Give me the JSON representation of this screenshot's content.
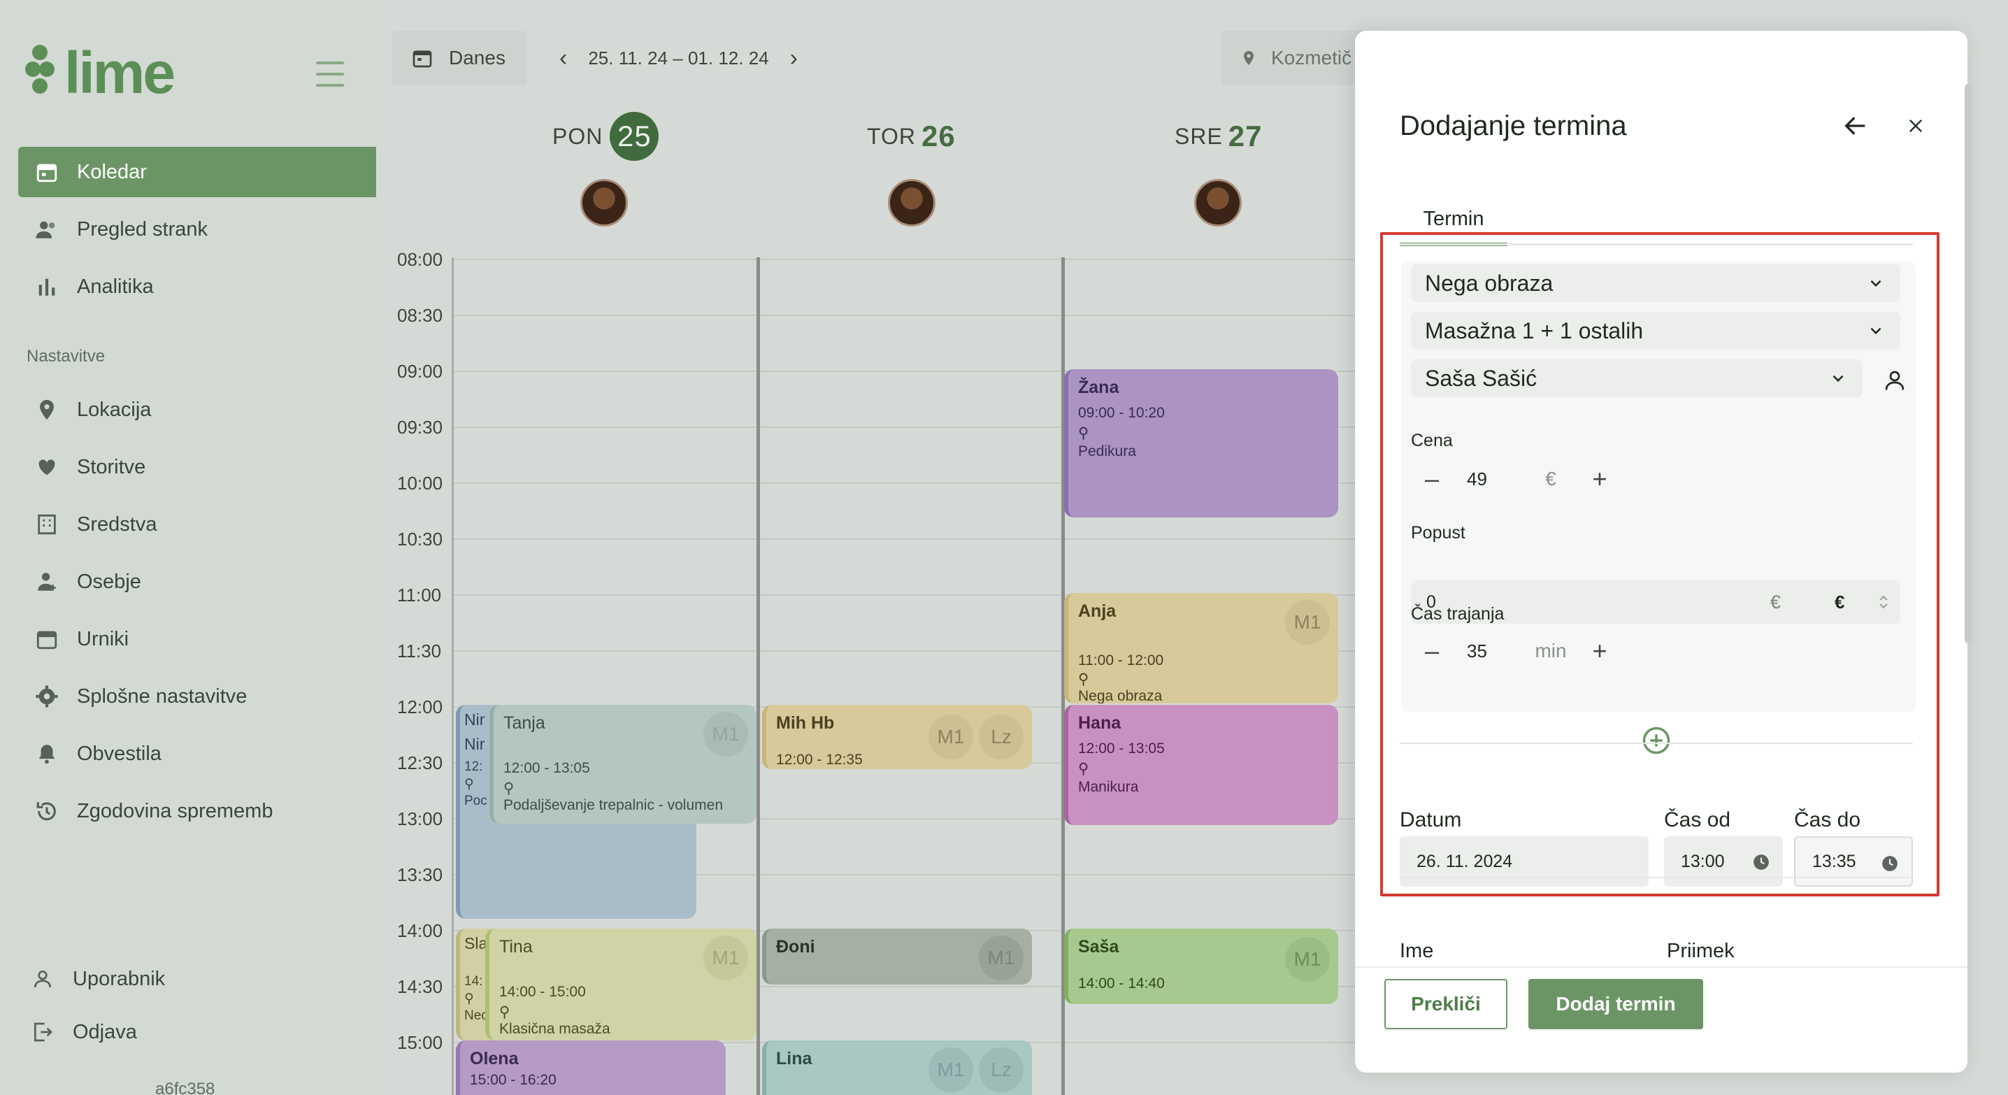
{
  "brand": {
    "name": "lime"
  },
  "sidebar": {
    "items": [
      {
        "label": "Koledar",
        "icon": "calendar-icon",
        "active": true
      },
      {
        "label": "Pregled strank",
        "icon": "users-icon"
      },
      {
        "label": "Analitika",
        "icon": "bar-chart-icon"
      }
    ],
    "section_label": "Nastavitve",
    "settings": [
      {
        "label": "Lokacija",
        "icon": "location-pin-icon"
      },
      {
        "label": "Storitve",
        "icon": "heart-hand-icon"
      },
      {
        "label": "Sredstva",
        "icon": "building-icon"
      },
      {
        "label": "Osebje",
        "icon": "staff-icon"
      },
      {
        "label": "Urniki",
        "icon": "schedule-icon"
      },
      {
        "label": "Splošne nastavitve",
        "icon": "gear-icon"
      },
      {
        "label": "Obvestila",
        "icon": "bell-icon"
      },
      {
        "label": "Zgodovina sprememb",
        "icon": "history-icon"
      }
    ],
    "user_label": "Uporabnik",
    "logout_label": "Odjava",
    "build_hash": "a6fc358"
  },
  "toolbar": {
    "today_label": "Danes",
    "date_range": "25. 11. 24 – 01. 12. 24",
    "location_label": "Kozmetič"
  },
  "days": [
    {
      "name": "PON",
      "num": "25"
    },
    {
      "name": "TOR",
      "num": "26"
    },
    {
      "name": "SRE",
      "num": "27"
    }
  ],
  "hours": [
    "08:00",
    "08:30",
    "09:00",
    "09:30",
    "10:00",
    "10:30",
    "11:00",
    "11:30",
    "12:00",
    "12:30",
    "13:00",
    "13:30",
    "14:00",
    "14:30",
    "15:00"
  ],
  "events": [
    {
      "title": "Žana",
      "time": "09:00 - 10:20",
      "service": "Pedikura"
    },
    {
      "title": "Anja",
      "time": "11:00 - 12:00",
      "service": "Nega obraza",
      "badge": "M1"
    },
    {
      "title": "Hana",
      "time": "12:00 - 13:05",
      "service": "Manikura"
    },
    {
      "title": "Saša",
      "time": "14:00 - 14:40",
      "badge": "M1"
    },
    {
      "title": "Tanja",
      "time": "12:00 - 13:05",
      "service": "Podaljševanje trepalnic - volumen",
      "badge": "M1",
      "side_a": "Nir",
      "side_b": "Nir",
      "side_c": "12:",
      "side_d": "Poc"
    },
    {
      "title": "Mih Hb",
      "time": "12:00 - 12:35",
      "badge": "M1",
      "badge2": "Lz"
    },
    {
      "title": "Tina",
      "time": "14:00 - 15:00",
      "service": "Klasična masaža",
      "badge": "M1",
      "side_a": "Sla",
      "side_c": "14:",
      "side_d": "Nec"
    },
    {
      "title": "Đoni",
      "badge": "M1"
    },
    {
      "title": "Olena",
      "time": "15:00 - 16:20"
    },
    {
      "title": "Lina",
      "badge": "M1",
      "badge2": "Lz"
    }
  ],
  "modal": {
    "title": "Dodajanje termina",
    "tab_label": "Termin",
    "service_select": "Nega obraza",
    "resource_select": "Masažna 1 + 1 ostalih",
    "staff_select": "Saša Sašić",
    "price_label": "Cena",
    "price_value": "49",
    "price_currency": "€",
    "discount_label": "Popust",
    "discount_value": "0",
    "discount_unit": "€",
    "discount_type": "€",
    "duration_label": "Čas trajanja",
    "duration_value": "35",
    "duration_unit": "min",
    "date_label": "Datum",
    "date_value": "26. 11. 2024",
    "from_label": "Čas od",
    "from_value": "13:00",
    "to_label": "Čas do",
    "to_value": "13:35",
    "first_name_label": "Ime",
    "last_name_label": "Priimek",
    "cancel_label": "Prekliči",
    "submit_label": "Dodaj termin"
  },
  "colors": {
    "brand": "#5c8f56",
    "primary": "#6c9566",
    "highlight": "#d63b30"
  }
}
